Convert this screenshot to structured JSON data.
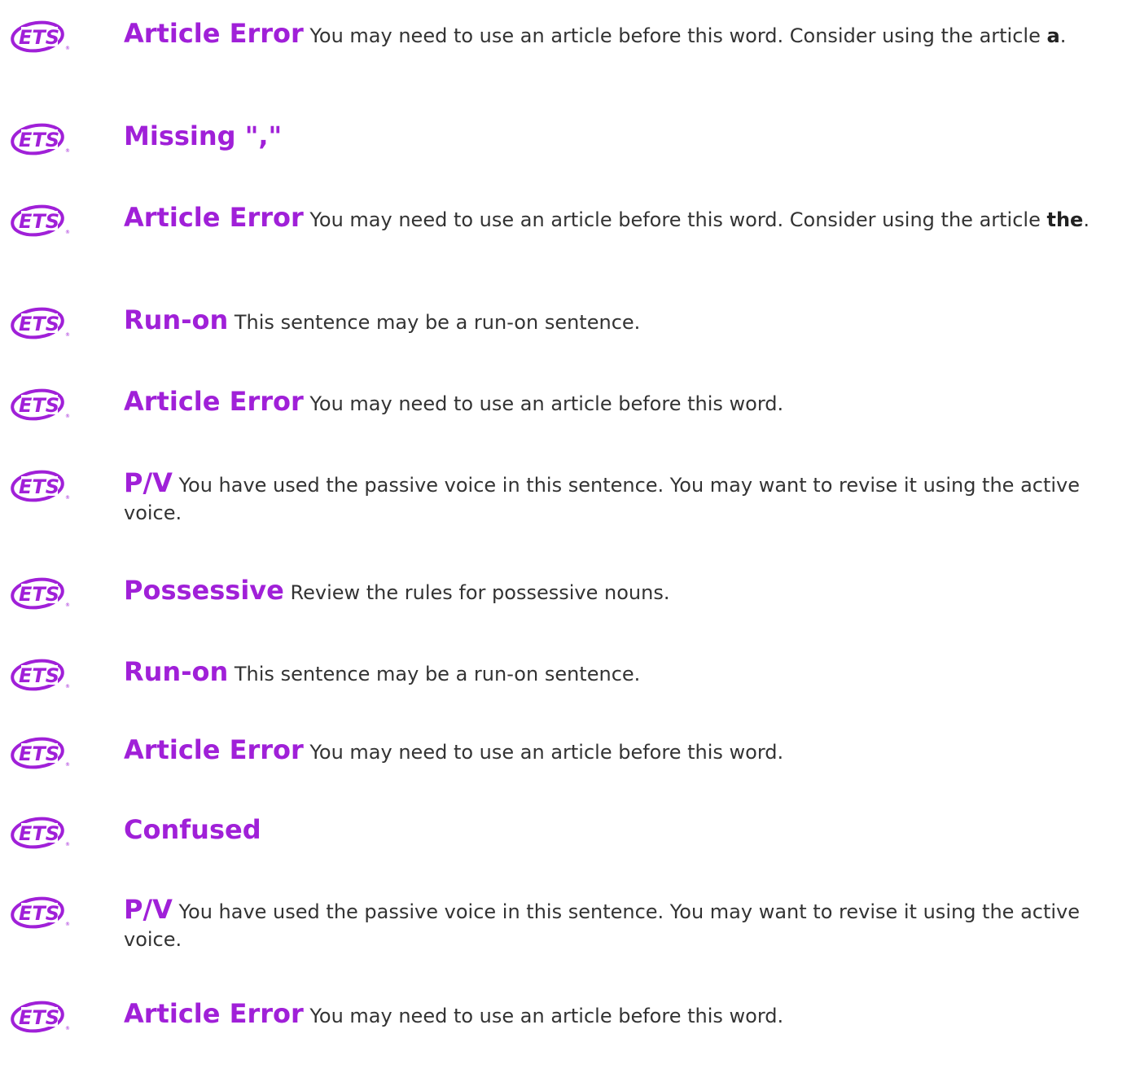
{
  "logo_text": "ETS",
  "colors": {
    "accent": "#a020d8",
    "logo": "#a020d8",
    "text": "#333333"
  },
  "items": [
    {
      "title": "Article Error",
      "desc": "You may need to use an article before this word. Consider using the article",
      "hint": "a",
      "end": "."
    },
    {
      "title": "Missing \",\"",
      "desc": "",
      "hint": "",
      "end": ""
    },
    {
      "title": "Article Error",
      "desc": "You may need to use an article before this word. Consider using the article",
      "hint": "the",
      "end": "."
    },
    {
      "title": "Run-on",
      "desc": "This sentence may be a run-on sentence.",
      "hint": "",
      "end": ""
    },
    {
      "title": "Article Error",
      "desc": "You may need to use an article before this word.",
      "hint": "",
      "end": ""
    },
    {
      "title": "P/V",
      "desc": "You have used the passive voice in this sentence. You may want to revise it using the active voice.",
      "hint": "",
      "end": ""
    },
    {
      "title": "Possessive",
      "desc": "Review the rules for possessive nouns.",
      "hint": "",
      "end": ""
    },
    {
      "title": "Run-on",
      "desc": "This sentence may be a run-on sentence.",
      "hint": "",
      "end": ""
    },
    {
      "title": "Article Error",
      "desc": "You may need to use an article before this word.",
      "hint": "",
      "end": ""
    },
    {
      "title": "Confused",
      "desc": "",
      "hint": "",
      "end": ""
    },
    {
      "title": "P/V",
      "desc": "You have used the passive voice in this sentence. You may want to revise it using the active voice.",
      "hint": "",
      "end": ""
    },
    {
      "title": "Article Error",
      "desc": "You may need to use an article before this word.",
      "hint": "",
      "end": ""
    }
  ]
}
